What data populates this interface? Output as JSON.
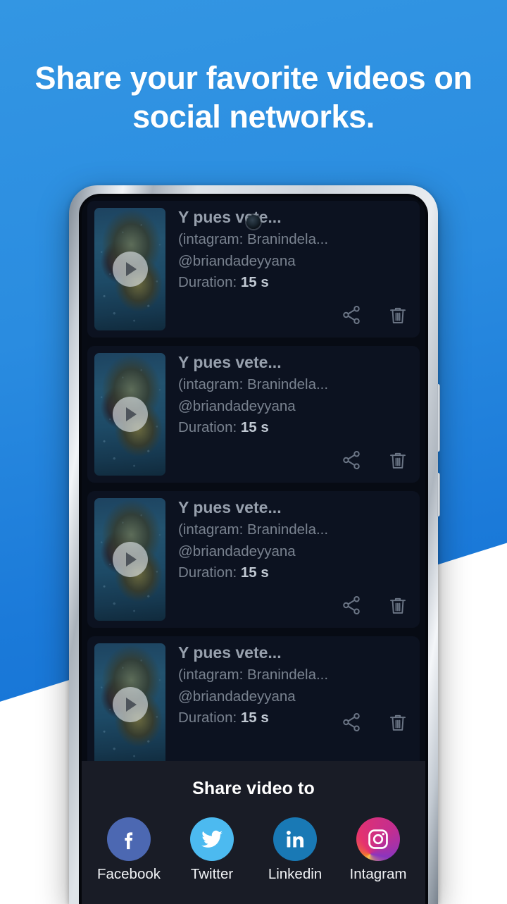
{
  "promo": {
    "headline": "Share your favorite videos on social networks.",
    "background_top_color": "#3396e3",
    "background_bottom_color": "#0e6bd1",
    "wedge_color": "#ffffff"
  },
  "device": {
    "frame_color": "#cfd5dc",
    "screen_background": "#070b14",
    "camera_icon": "punch-hole-camera",
    "side_buttons": [
      "volume-rocker",
      "power-button"
    ]
  },
  "app": {
    "list": {
      "card_background": "#0c1220",
      "items": [
        {
          "title": "Y pues vete...",
          "source": "(intagram: Branindela...",
          "handle": "@briandadeyyana",
          "duration_label": "Duration:",
          "duration_value": "15 s",
          "thumbnail": "video-thumbnail",
          "play_icon": "play-icon",
          "share_icon": "share-icon",
          "delete_icon": "trash-icon"
        },
        {
          "title": "Y pues vete...",
          "source": "(intagram: Branindela...",
          "handle": "@briandadeyyana",
          "duration_label": "Duration:",
          "duration_value": "15 s",
          "thumbnail": "video-thumbnail",
          "play_icon": "play-icon",
          "share_icon": "share-icon",
          "delete_icon": "trash-icon"
        },
        {
          "title": "Y pues vete...",
          "source": "(intagram: Branindela...",
          "handle": "@briandadeyyana",
          "duration_label": "Duration:",
          "duration_value": "15 s",
          "thumbnail": "video-thumbnail",
          "play_icon": "play-icon",
          "share_icon": "share-icon",
          "delete_icon": "trash-icon"
        },
        {
          "title": "Y pues vete...",
          "source": "(intagram: Branindela...",
          "handle": "@briandadeyyana",
          "duration_label": "Duration:",
          "duration_value": "15 s",
          "thumbnail": "video-thumbnail",
          "play_icon": "play-icon",
          "share_icon": "share-icon",
          "delete_icon": "trash-icon"
        }
      ]
    },
    "share_sheet": {
      "title": "Share video to",
      "background": "#191c26",
      "targets": [
        {
          "label": "Facebook",
          "icon": "facebook-icon",
          "color": "#4c68b2"
        },
        {
          "label": "Twitter",
          "icon": "twitter-icon",
          "color": "#4cbaf0"
        },
        {
          "label": "Linkedin",
          "icon": "linkedin-icon",
          "color": "#1979b5"
        },
        {
          "label": "Intagram",
          "icon": "instagram-icon",
          "color": "#c42e8f"
        }
      ]
    }
  }
}
